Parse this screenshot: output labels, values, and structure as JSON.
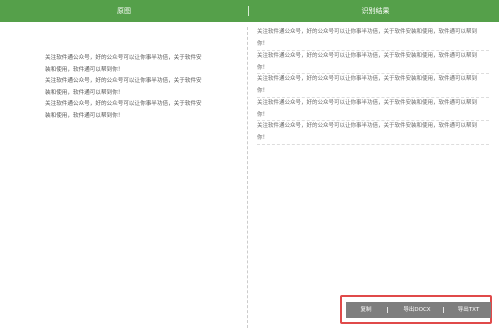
{
  "header": {
    "left_title": "原图",
    "separator": "|",
    "right_title": "识别结果"
  },
  "left_pane": {
    "text": "关注软件通公众号，好的公众号可以让你事半功倍，关于软件安装和使用，软件通可以帮到你！\n关注软件通公众号，好的公众号可以让你事半功倍，关于软件安装和使用，软件通可以帮到你！\n关注软件通公众号，好的公众号可以让你事半功倍，关于软件安装和使用，软件通可以帮到你！"
  },
  "right_pane": {
    "items": [
      {
        "line1": "关注软件通公众号，好的公众号可以让你事半功倍，关于软件安装和使用，软件通可以帮到",
        "line2": "你！"
      },
      {
        "line1": "关注软件通公众号，好的公众号可以让你事半功倍，关于软件安装和使用，软件通可以帮到",
        "line2": "你！"
      },
      {
        "line1": "关注软件通公众号，好的公众号可以让你事半功倍，关于软件安装和使用，软件通可以帮到",
        "line2": "你！"
      },
      {
        "line1": "关注软件通公众号，好的公众号可以让你事半功倍，关于软件安装和使用，软件通可以帮到",
        "line2": "你！"
      },
      {
        "line1": "关注软件通公众号，好的公众号可以让你事半功倍，关于软件安装和使用，软件通可以帮到",
        "line2": "你！"
      }
    ]
  },
  "actions": {
    "copy_label": "复制",
    "separator": "|",
    "docx_label": "导出DOCX",
    "txt_label": "导出TXT"
  },
  "colors": {
    "header_bg": "#55a04a",
    "action_bg": "#7e7e7e",
    "highlight_border": "#e04a4a"
  }
}
